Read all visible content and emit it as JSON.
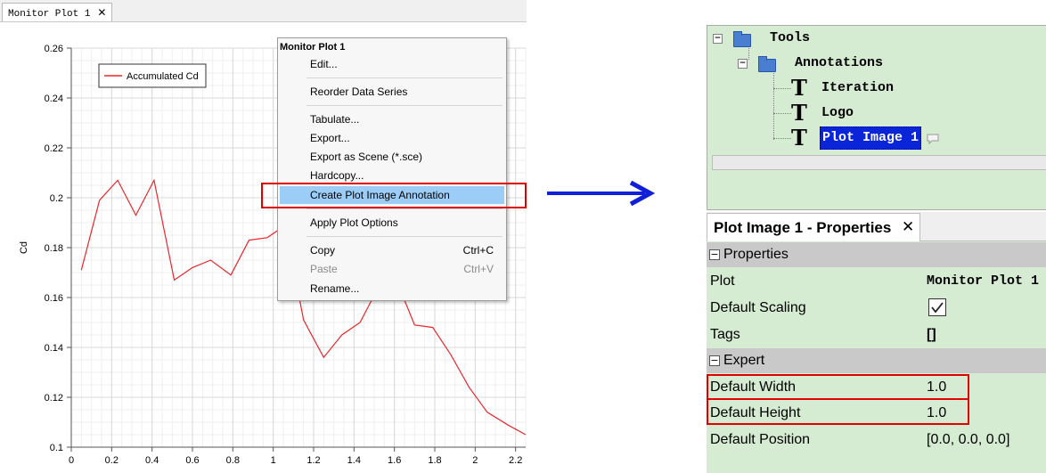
{
  "plot_window": {
    "tab_title": "Monitor Plot 1",
    "tab_close": "✕"
  },
  "chart_data": {
    "type": "line",
    "xlabel": "",
    "ylabel": "Cd",
    "xlim": [
      0,
      2.25
    ],
    "ylim": [
      0.1,
      0.26
    ],
    "x_ticks": [
      "0",
      "0.2",
      "0.4",
      "0.6",
      "0.8",
      "1",
      "1.2",
      "1.4",
      "1.6",
      "1.8",
      "2",
      "2.2"
    ],
    "y_ticks": [
      "0.1",
      "0.12",
      "0.14",
      "0.16",
      "0.18",
      "0.2",
      "0.22",
      "0.24",
      "0.26"
    ],
    "grid": true,
    "legend_position": "top-left",
    "series": [
      {
        "name": "Accumulated Cd",
        "color": "#e8262b",
        "x": [
          0.05,
          0.14,
          0.23,
          0.32,
          0.41,
          0.51,
          0.6,
          0.69,
          0.79,
          0.88,
          0.97,
          1.06,
          1.15,
          1.25,
          1.34,
          1.43,
          1.52,
          1.61,
          1.7,
          1.79,
          1.88,
          1.97,
          2.06,
          2.16,
          2.25
        ],
        "y": [
          0.171,
          0.199,
          0.207,
          0.193,
          0.207,
          0.167,
          0.172,
          0.175,
          0.169,
          0.183,
          0.184,
          0.189,
          0.151,
          0.136,
          0.145,
          0.15,
          0.164,
          0.167,
          0.149,
          0.148,
          0.137,
          0.124,
          0.114,
          0.109,
          0.105
        ]
      }
    ]
  },
  "context_menu": {
    "header": "Monitor Plot 1",
    "items": [
      {
        "label": "Edit...",
        "shortcut": ""
      },
      {
        "label": "Reorder Data Series",
        "shortcut": ""
      },
      {
        "label": "Tabulate...",
        "shortcut": ""
      },
      {
        "label": "Export...",
        "shortcut": ""
      },
      {
        "label": "Export as Scene (*.sce)",
        "shortcut": ""
      },
      {
        "label": "Hardcopy...",
        "shortcut": ""
      },
      {
        "label": "Create Plot Image Annotation",
        "shortcut": ""
      },
      {
        "label": "Apply Plot Options",
        "shortcut": ""
      },
      {
        "label": "Copy",
        "shortcut": "Ctrl+C"
      },
      {
        "label": "Paste",
        "shortcut": "Ctrl+V"
      },
      {
        "label": "Rename...",
        "shortcut": ""
      }
    ],
    "highlight_color": "#9ccdf6"
  },
  "tree": {
    "nodes": [
      {
        "label": "Tools",
        "icon": "folder-icon"
      },
      {
        "label": "Annotations",
        "icon": "folder-icon"
      },
      {
        "label": "Iteration",
        "icon": "text-annotation-icon"
      },
      {
        "label": "Logo",
        "icon": "text-annotation-icon"
      },
      {
        "label": "Plot Image 1",
        "icon": "text-annotation-icon"
      }
    ],
    "expand_glyph": "⊟"
  },
  "properties_panel": {
    "tab_title": "Plot Image 1 - Properties",
    "tab_close": "✕",
    "group_properties": "Properties",
    "group_expert": "Expert",
    "rows": {
      "plot": {
        "key": "Plot",
        "value": "Monitor Plot 1"
      },
      "default_scaling": {
        "key": "Default Scaling",
        "checked": true
      },
      "tags": {
        "key": "Tags",
        "value": "[]"
      },
      "default_width": {
        "key": "Default Width",
        "value": "1.0"
      },
      "default_height": {
        "key": "Default Height",
        "value": "1.0"
      },
      "default_position": {
        "key": "Default Position",
        "value": "[0.0, 0.0, 0.0]"
      }
    }
  },
  "colors": {
    "highlight_border": "#e00000",
    "arrow": "#1020d8",
    "panel_green": "#d5ebd2",
    "selection": "#0a24d8"
  }
}
